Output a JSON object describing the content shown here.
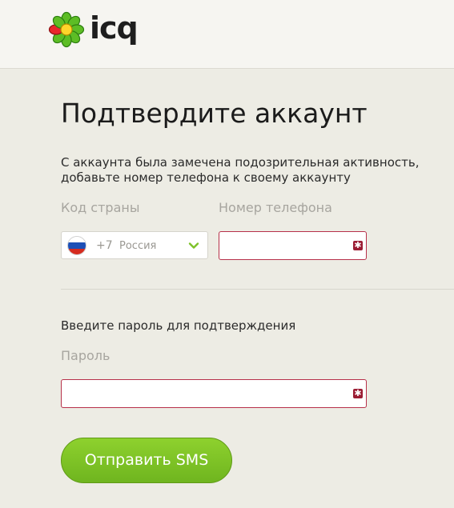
{
  "header": {
    "logo_text": "icq"
  },
  "page": {
    "title": "Подтвердите аккаунт",
    "description_line1": "С аккаунта была замечена подозрительная активность,",
    "description_line2": "добавьте номер телефона к своему аккаунту"
  },
  "phone_form": {
    "country_label": "Код страны",
    "phone_label": "Номер телефона",
    "country": {
      "code": "+7",
      "name": "Россия",
      "flag_icon": "flag-russia-icon"
    },
    "phone_value": ""
  },
  "password_form": {
    "section_label": "Введите пароль для подтверждения",
    "password_label": "Пароль",
    "password_value": ""
  },
  "submit": {
    "label": "Отправить SMS"
  },
  "colors": {
    "accent_green": "#7ec229",
    "error_border": "#b7314a",
    "background": "#edece4",
    "header_background": "#f6f5f1"
  }
}
